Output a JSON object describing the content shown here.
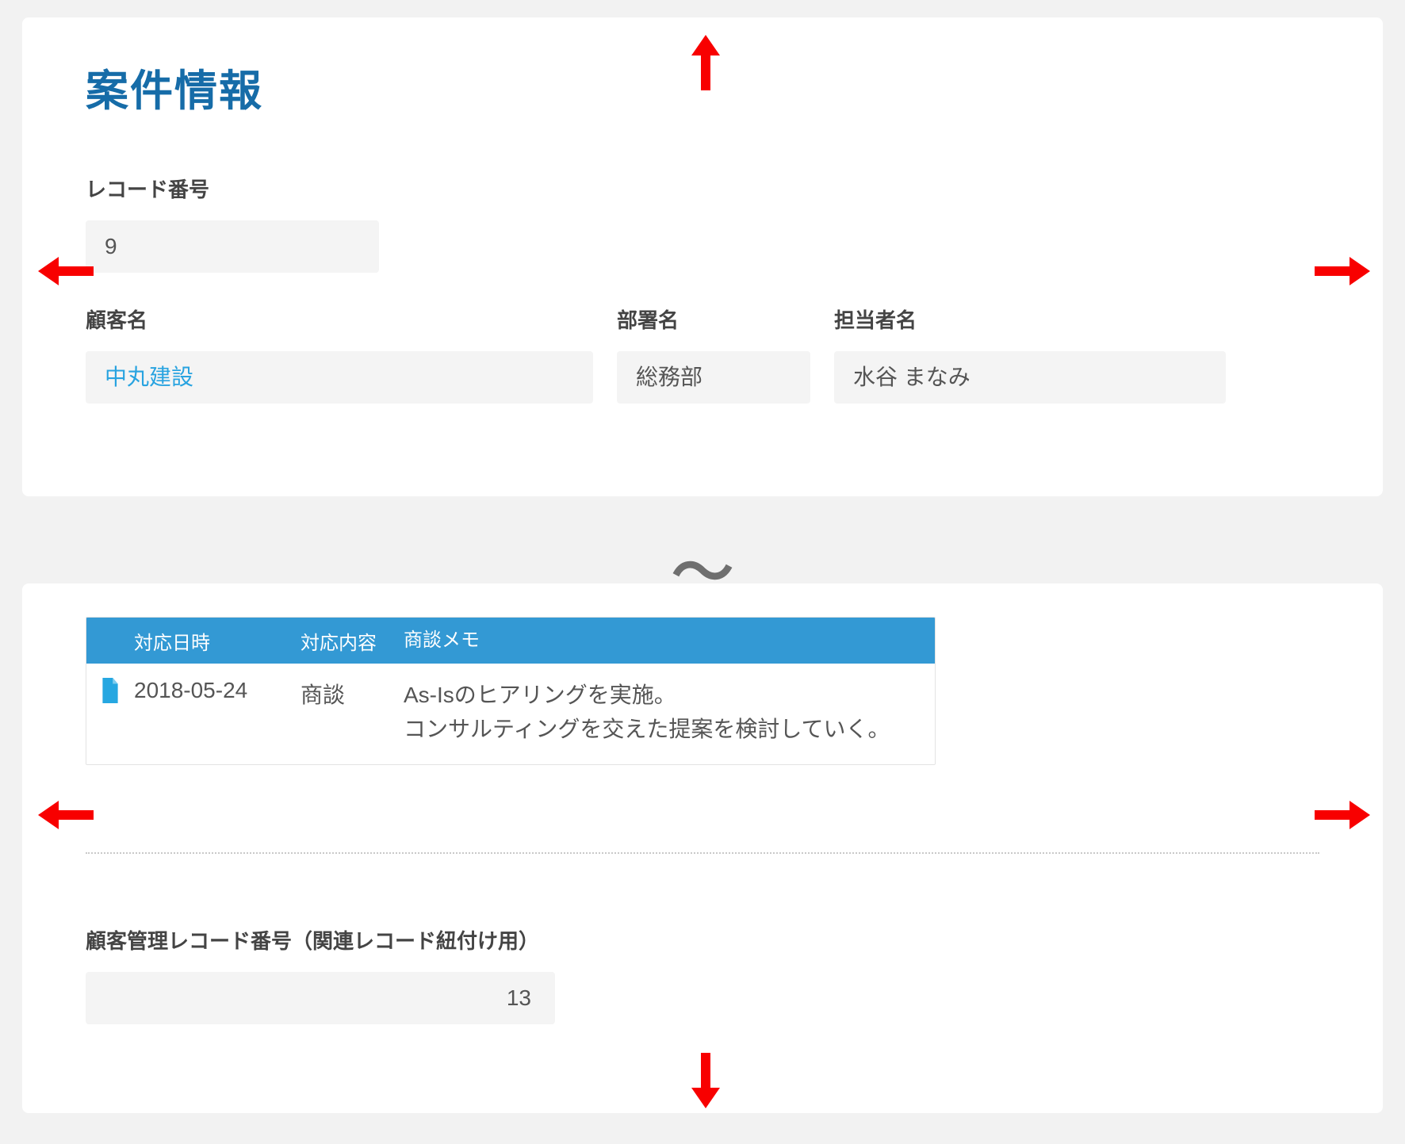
{
  "page": {
    "title": "案件情報"
  },
  "fields": {
    "record_number": {
      "label": "レコード番号",
      "value": "9"
    },
    "customer": {
      "label": "顧客名",
      "value": "中丸建設"
    },
    "department": {
      "label": "部署名",
      "value": "総務部"
    },
    "person": {
      "label": "担当者名",
      "value": "水谷 まなみ"
    },
    "linked_record": {
      "label": "顧客管理レコード番号（関連レコード紐付け用）",
      "value": "13"
    }
  },
  "table": {
    "headers": {
      "date": "対応日時",
      "type": "対応内容",
      "memo": "商談メモ"
    },
    "rows": [
      {
        "icon": "document-icon",
        "date": "2018-05-24",
        "type": "商談",
        "memo": "As-Isのヒアリングを実施。\nコンサルティングを交えた提案を検討していく。"
      }
    ]
  }
}
